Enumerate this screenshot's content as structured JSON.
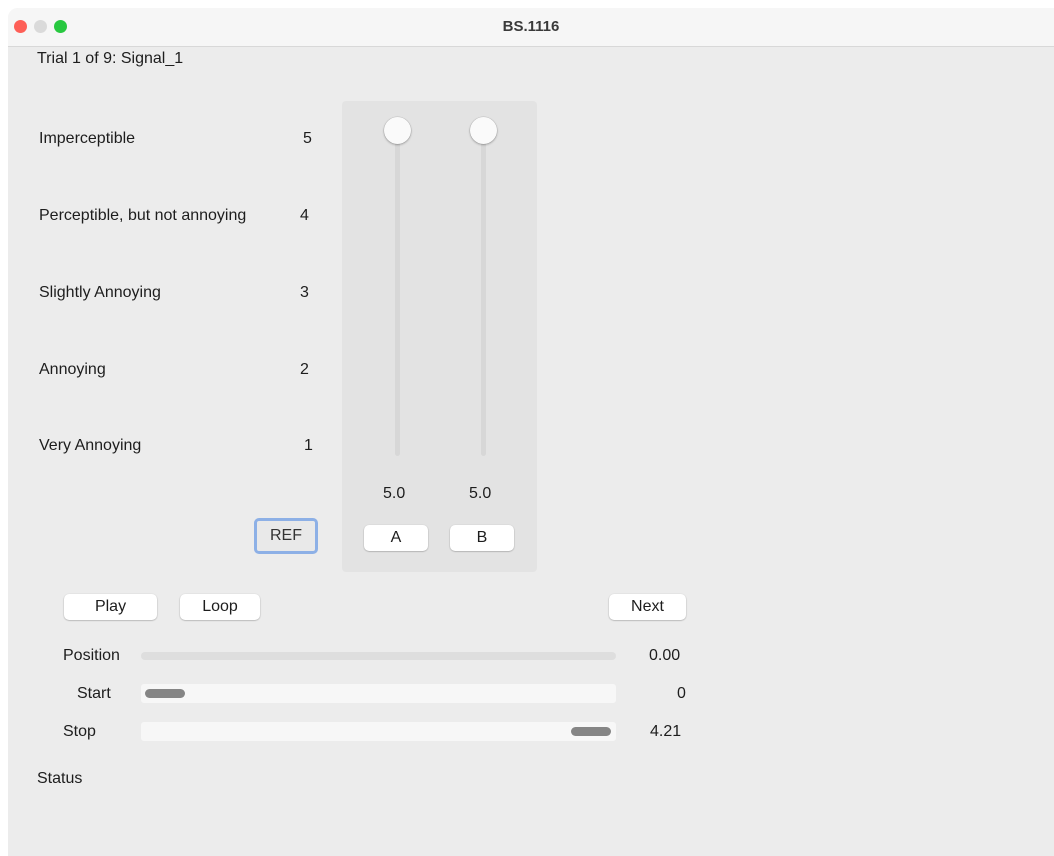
{
  "window": {
    "title": "BS.1116"
  },
  "trial_label": "Trial 1 of 9: Signal_1",
  "scale": [
    {
      "label": "Imperceptible",
      "value": "5"
    },
    {
      "label": "Perceptible, but not annoying",
      "value": "4"
    },
    {
      "label": "Slightly Annoying",
      "value": "3"
    },
    {
      "label": "Annoying",
      "value": "2"
    },
    {
      "label": "Very Annoying",
      "value": "1"
    }
  ],
  "sliders": [
    {
      "name": "A",
      "value": "5.0",
      "level": 5.0
    },
    {
      "name": "B",
      "value": "5.0",
      "level": 5.0
    }
  ],
  "buttons": {
    "ref": "REF",
    "a": "A",
    "b": "B",
    "play": "Play",
    "loop": "Loop",
    "next": "Next"
  },
  "transport": {
    "position": {
      "label": "Position",
      "value": "0.00"
    },
    "start": {
      "label": "Start",
      "value": "0"
    },
    "stop": {
      "label": "Stop",
      "value": "4.21"
    }
  },
  "status_label": "Status"
}
